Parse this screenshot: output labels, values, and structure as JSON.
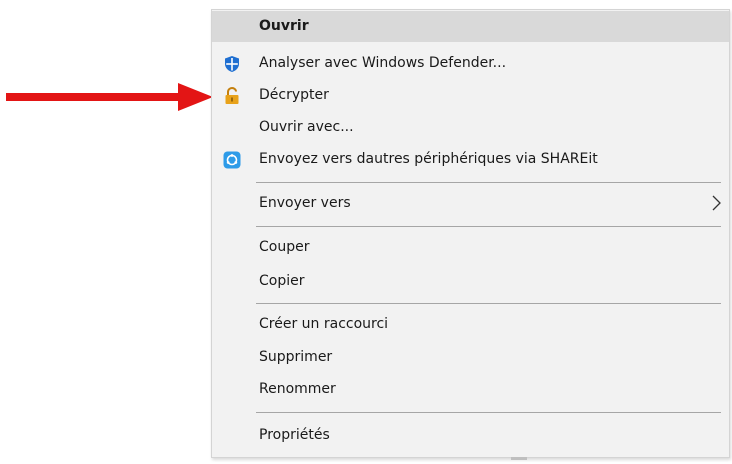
{
  "menu": {
    "items": [
      {
        "label": "Ouvrir",
        "icon": null,
        "highlight": true,
        "bold": true
      },
      {
        "label": "Analyser avec Windows Defender...",
        "icon": "windows-defender-icon"
      },
      {
        "label": "Décrypter",
        "icon": "unlock-padlock-icon"
      },
      {
        "label": "Ouvrir avec...",
        "icon": null
      },
      {
        "label": "Envoyez vers dautres périphériques via SHAREit",
        "icon": "shareit-icon"
      },
      {
        "label": "Envoyer vers",
        "icon": null,
        "submenu": true
      },
      {
        "label": "Couper",
        "icon": null
      },
      {
        "label": "Copier",
        "icon": null
      },
      {
        "label": "Créer un raccourci",
        "icon": null
      },
      {
        "label": "Supprimer",
        "icon": null
      },
      {
        "label": "Renommer",
        "icon": null
      },
      {
        "label": "Propriétés",
        "icon": null
      }
    ]
  },
  "annotation": {
    "arrow_color": "#e31515",
    "points_to": "Décrypter"
  },
  "colors": {
    "menu_background": "#f2f2f2",
    "highlight": "#d9d9d9",
    "separator": "#a6a6a6",
    "defender_blue": "#1f6fd1",
    "padlock_orange": "#e8a21a",
    "shareit_blue": "#2d9be8"
  }
}
